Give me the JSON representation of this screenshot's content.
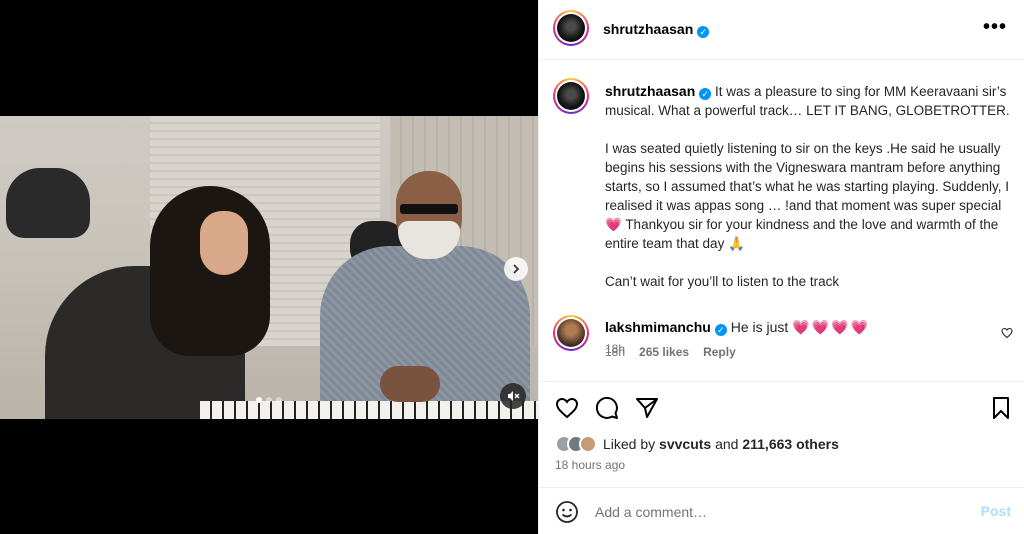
{
  "post": {
    "author": "shrutzhaasan",
    "caption_lines": [
      "It was a pleasure to sing for MM Keeravaani sir’s musical. What a powerful track… LET IT BANG, GLOBETROTTER.",
      "I was seated quietly listening to sir on the keys .He said he usually begins his sessions with the Vigneswara mantram before anything starts, so I assumed that’s what he was starting playing. Suddenly, I realised it was appas song … !and that moment was super special 💗 Thankyou sir for your kindness and the love and warmth of the entire team that day 🙏",
      "Can’t wait for you’ll to listen to the track"
    ],
    "caption_time": "18h",
    "likes_prefix": "Liked by",
    "liked_by_user": "svvcuts",
    "likes_and": "and",
    "likes_others": "211,663 others",
    "posted_time": "18 hours ago",
    "more_label": "•••"
  },
  "comment": {
    "author": "lakshmimanchu",
    "text": "He is just",
    "hearts": "💗💗💗💗",
    "time": "18h",
    "likes": "265 likes",
    "reply_label": "Reply"
  },
  "composer": {
    "placeholder": "Add a comment…",
    "post_label": "Post"
  },
  "icons": {
    "like": "heart-icon",
    "comment": "comment-icon",
    "share": "share-icon",
    "save": "bookmark-icon",
    "emoji": "emoji-icon",
    "mute": "muted-speaker-icon",
    "next": "chevron-right-icon"
  },
  "colors": {
    "verified": "#0095f6",
    "post_button": "#b3dbff",
    "heart": "#ed4956"
  },
  "carousel": {
    "total": 3,
    "current": 1
  }
}
